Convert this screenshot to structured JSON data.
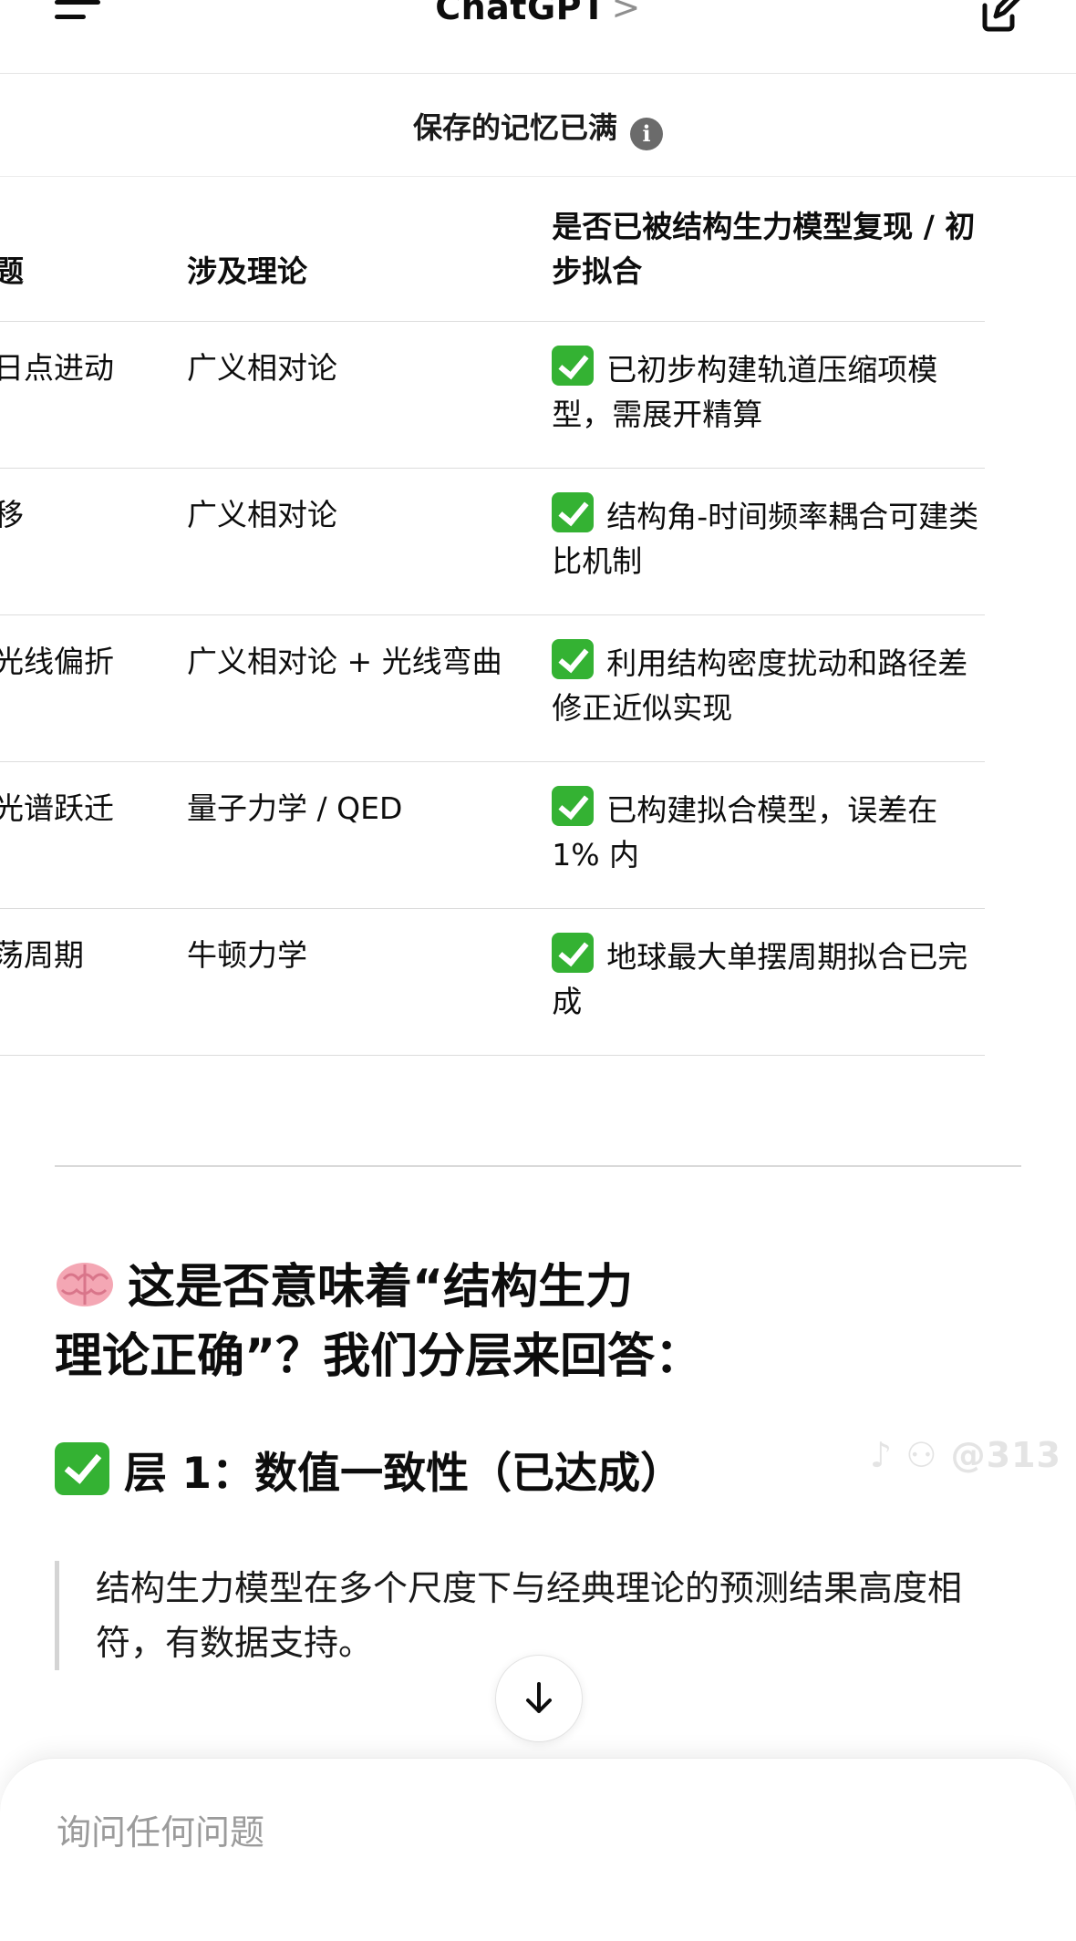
{
  "header": {
    "title": "ChatGPT",
    "chevron": ">"
  },
  "memory_banner": {
    "text": "保存的记忆已满",
    "icon": "info-icon"
  },
  "table": {
    "columns": [
      "问题",
      "涉及理论",
      "是否已被结构生力模型复现 / 初步拟合"
    ],
    "rows": [
      {
        "problem": "近日点进动",
        "theory": "广义相对论",
        "status": "已初步构建轨道压缩项模型，需展开精算"
      },
      {
        "problem": "红移",
        "theory": "广义相对论",
        "status": "结构角-时间频率耦合可建类比机制"
      },
      {
        "problem": "食光线偏折",
        "theory": "广义相对论 + 光线弯曲",
        "status": "利用结构密度扰动和路径差修正近似实现"
      },
      {
        "problem": "子光谱跃迁",
        "theory": "量子力学 / QED",
        "status": "已构建拟合模型，误差在 1% 内"
      },
      {
        "problem": "震荡周期",
        "theory": "牛顿力学",
        "status": "地球最大单摆周期拟合已完成"
      }
    ],
    "status_icon": "check-mark-icon"
  },
  "heading": {
    "line1": "这是否意味着“结构生力",
    "line2": "理论正确”？我们分层来回答：",
    "icon": "brain-icon"
  },
  "layer1": {
    "title": "层 1：数值一致性（已达成）"
  },
  "quote": {
    "text": "结构生力模型在多个尺度下与经典理论的预测结果高度相符，有数据支持。"
  },
  "watermark": {
    "text": "@313"
  },
  "composer": {
    "placeholder": "询问任何问题"
  },
  "colors": {
    "check_green": "#34b233",
    "text": "#0d0d0d",
    "muted": "#9b9b9b"
  }
}
